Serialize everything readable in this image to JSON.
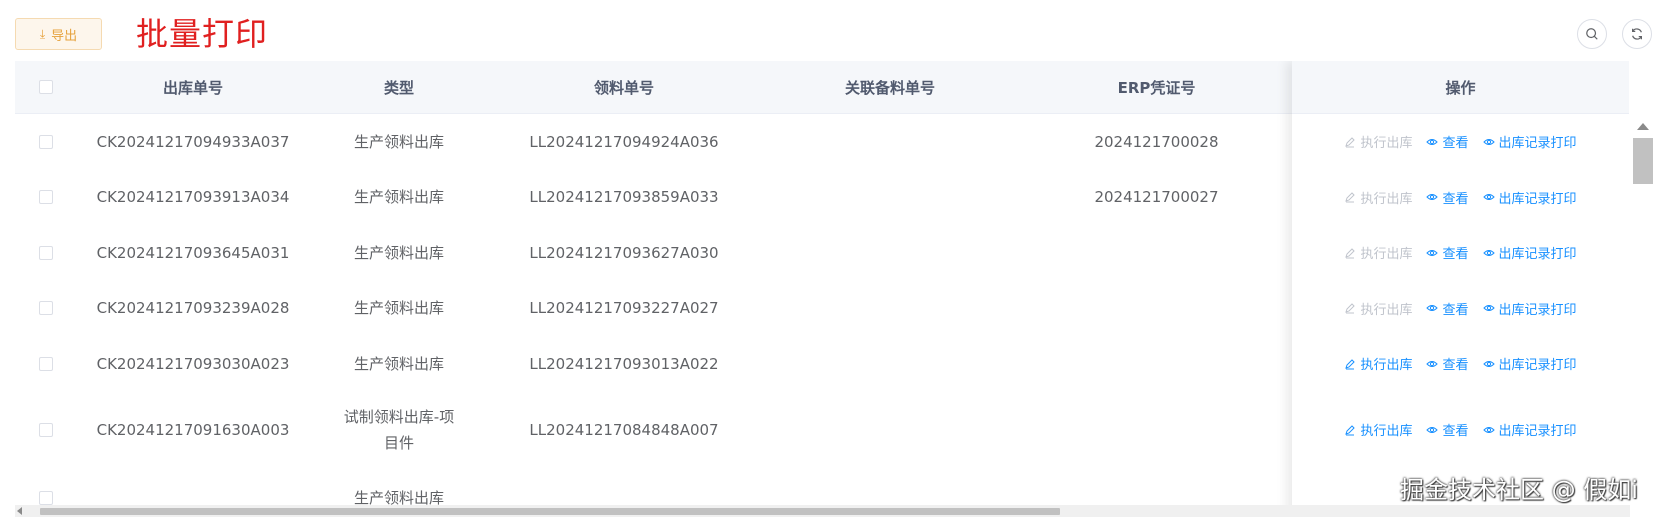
{
  "toolbar": {
    "export_label": "导出",
    "export_icon": "download-icon",
    "title": "批量打印",
    "search_icon": "search-icon",
    "refresh_icon": "refresh-icon"
  },
  "table": {
    "columns": [
      "出库单号",
      "类型",
      "领料单号",
      "关联备料单号",
      "ERP凭证号",
      "操作"
    ],
    "rows": [
      {
        "out_no": "CK20241217094933A037",
        "type_line1": "生产领料出库",
        "type_line2": "",
        "pick_no": "LL20241217094924A036",
        "prep_no": "",
        "erp_no": "2024121700028",
        "execute_enabled": false
      },
      {
        "out_no": "CK20241217093913A034",
        "type_line1": "生产领料出库",
        "type_line2": "",
        "pick_no": "LL20241217093859A033",
        "prep_no": "",
        "erp_no": "2024121700027",
        "execute_enabled": false
      },
      {
        "out_no": "CK20241217093645A031",
        "type_line1": "生产领料出库",
        "type_line2": "",
        "pick_no": "LL20241217093627A030",
        "prep_no": "",
        "erp_no": "",
        "execute_enabled": false
      },
      {
        "out_no": "CK20241217093239A028",
        "type_line1": "生产领料出库",
        "type_line2": "",
        "pick_no": "LL20241217093227A027",
        "prep_no": "",
        "erp_no": "",
        "execute_enabled": false
      },
      {
        "out_no": "CK20241217093030A023",
        "type_line1": "生产领料出库",
        "type_line2": "",
        "pick_no": "LL20241217093013A022",
        "prep_no": "",
        "erp_no": "",
        "execute_enabled": true
      },
      {
        "out_no": "CK20241217091630A003",
        "type_line1": "试制领料出库-项",
        "type_line2": "目件",
        "pick_no": "LL20241217084848A007",
        "prep_no": "",
        "erp_no": "",
        "execute_enabled": true
      },
      {
        "out_no": "",
        "type_line1": "生产领料出库",
        "type_line2": "",
        "pick_no": "",
        "prep_no": "",
        "erp_no": "",
        "execute_enabled": true
      }
    ],
    "actions": {
      "execute_label": "执行出库",
      "view_label": "查看",
      "print_label": "出库记录打印"
    }
  },
  "colors": {
    "accent": "#1890ff",
    "title_red": "#e02020",
    "warning": "#e6a23c",
    "disabled": "#c0c4cc"
  },
  "watermark": "掘金技术社区 @ 假如i"
}
